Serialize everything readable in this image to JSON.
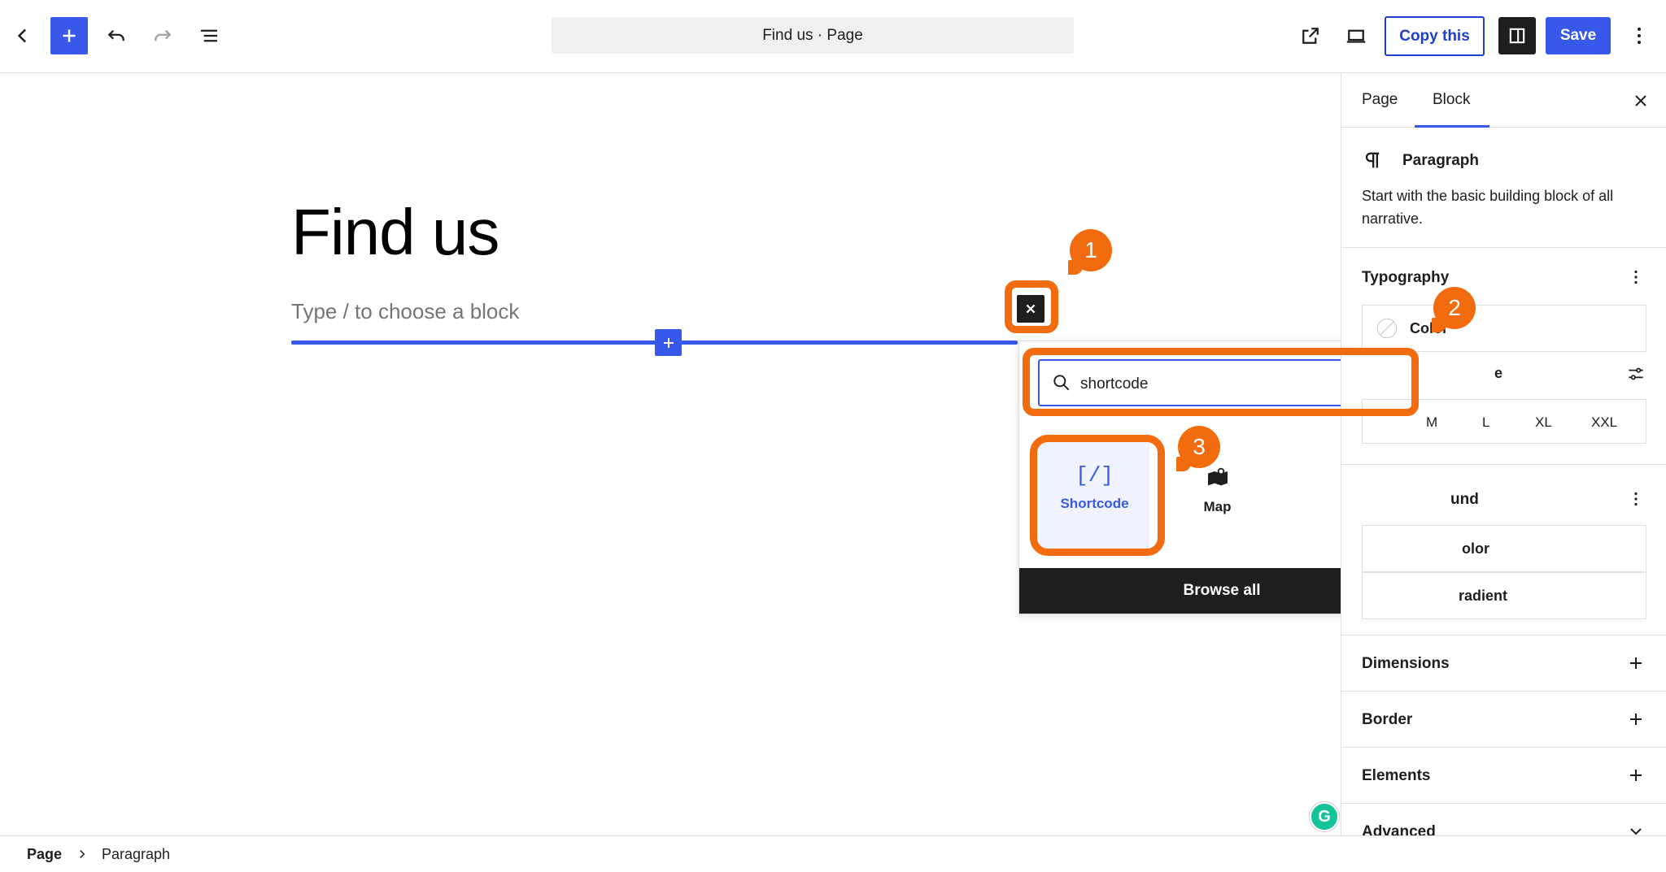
{
  "toolbar": {
    "document_title": "Find us · Page",
    "copy_label": "Copy this",
    "save_label": "Save"
  },
  "canvas": {
    "title": "Find us",
    "placeholder": "Type / to choose a block"
  },
  "inserter": {
    "search_value": "shortcode",
    "results": [
      {
        "label": "Shortcode",
        "icon": "shortcode-icon",
        "icon_text": "[/]",
        "selected": true
      },
      {
        "label": "Map",
        "icon": "map-icon",
        "selected": false
      }
    ],
    "browse_all_label": "Browse all"
  },
  "annotations": {
    "badge_1": "1",
    "badge_2": "2",
    "badge_3": "3",
    "color": "#f26b0f"
  },
  "sidebar": {
    "tabs": [
      "Page",
      "Block"
    ],
    "active_tab": "Block",
    "block_name": "Paragraph",
    "block_description": "Start with the basic building block of all narrative.",
    "typography": {
      "heading": "Typography",
      "color_label": "Color",
      "size_heading_visible": "e",
      "sizes": [
        "M",
        "L",
        "XL",
        "XXL"
      ]
    },
    "background": {
      "heading_visible": "und",
      "color_label_visible": "olor",
      "gradient_label_visible": "radient"
    },
    "panels": [
      "Dimensions",
      "Border",
      "Elements",
      "Advanced"
    ]
  },
  "footer": {
    "breadcrumbs": [
      "Page",
      "Paragraph"
    ]
  },
  "colors": {
    "accent": "#3858e9",
    "dark": "#1e1e1e",
    "highlight": "#f26b0f"
  }
}
